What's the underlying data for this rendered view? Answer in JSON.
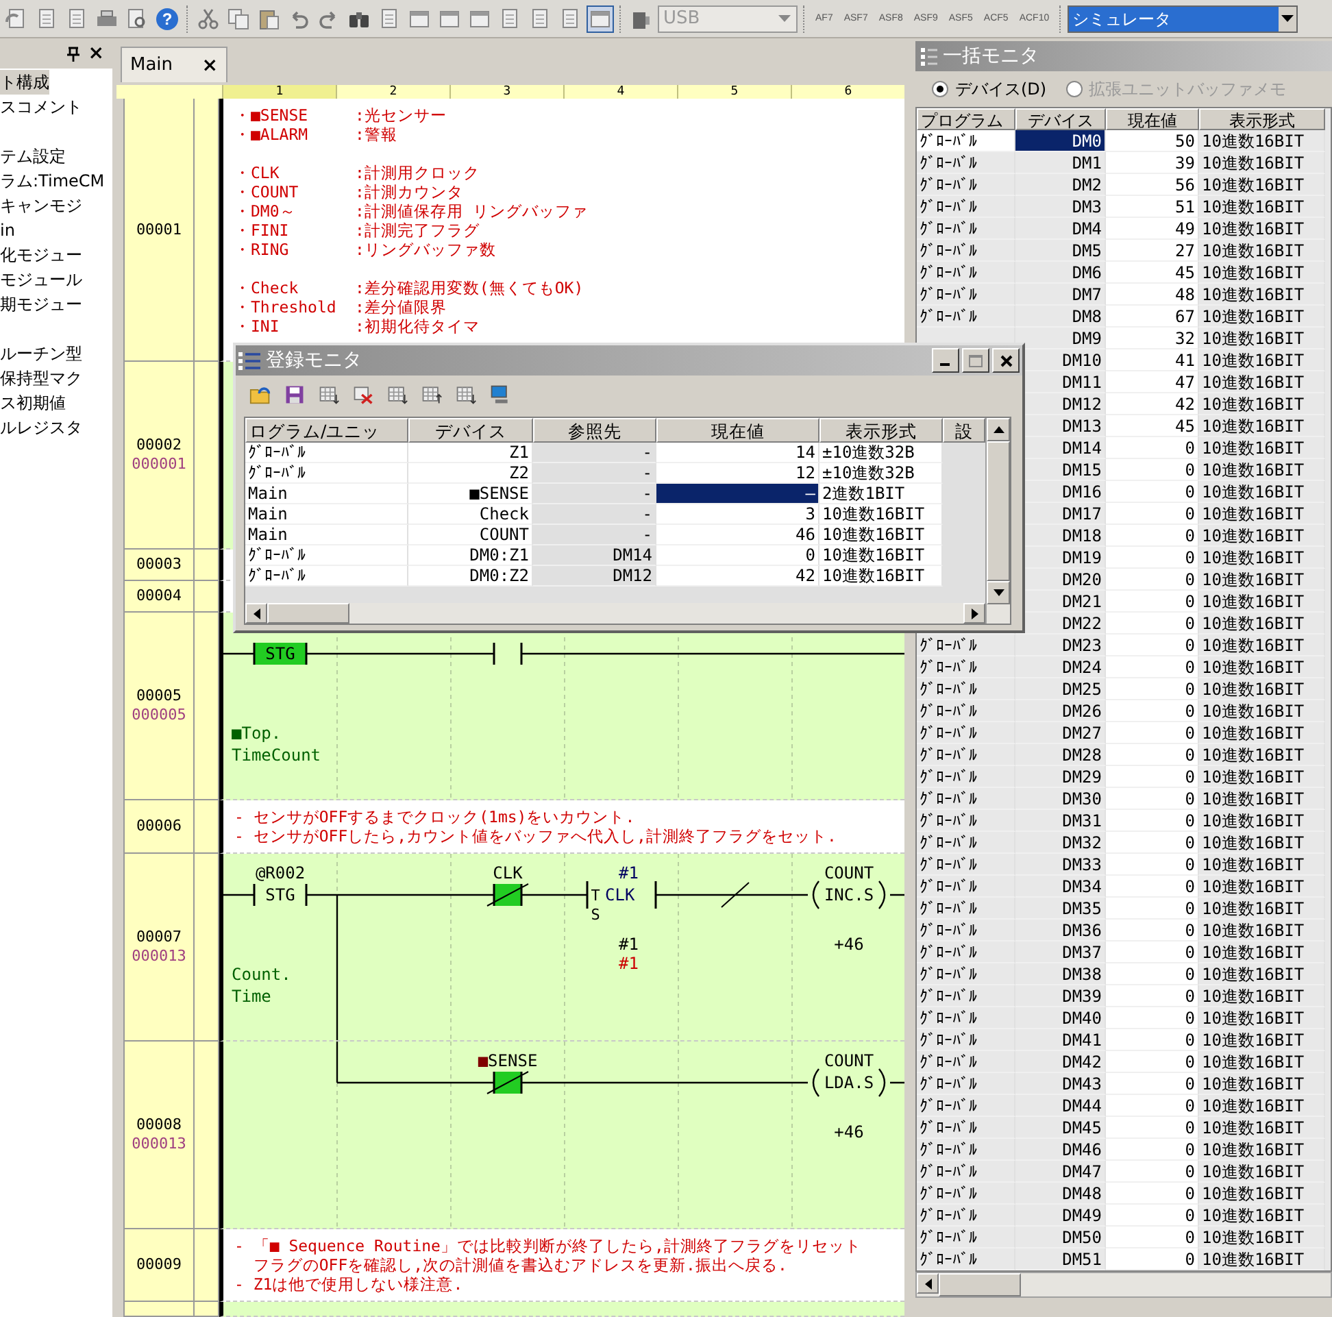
{
  "toolbar": {
    "help_glyph": "?",
    "connection": {
      "value": "USB",
      "disabled": true
    },
    "instruction_buttons": [
      "AF7",
      "ASF7",
      "ASF8",
      "ASF9",
      "ASF5",
      "ACF5",
      "ACF10"
    ],
    "mode": {
      "value": "シミュレータ"
    }
  },
  "project_panel": {
    "close_glyph": "×",
    "groups": [
      [
        {
          "label": "ト構成",
          "selected": true
        },
        {
          "label": "スコメント",
          "selected": false
        }
      ],
      [
        {
          "label": "テム設定",
          "selected": false
        },
        {
          "label": "ラム:TimeCM",
          "selected": false
        },
        {
          "label": "キャンモジ",
          "selected": false
        },
        {
          "label": "in",
          "selected": false
        },
        {
          "label": "化モジュー",
          "selected": false
        },
        {
          "label": "モジュール",
          "selected": false
        },
        {
          "label": "期モジュー",
          "selected": false
        }
      ],
      [
        {
          "label": "ルーチン型",
          "selected": false
        },
        {
          "label": "保持型マク",
          "selected": false
        },
        {
          "label": "ス初期値",
          "selected": false
        },
        {
          "label": "ルレジスタ",
          "selected": false
        }
      ]
    ]
  },
  "editor": {
    "tab": {
      "label": "Main",
      "close": "×"
    },
    "columns": [
      "1",
      "2",
      "3",
      "4",
      "5",
      "6"
    ],
    "rungs": [
      {
        "number": "00001",
        "kind": "comment",
        "groups": [
          [
            {
              "key": "・■SENSE",
              "text": ":光センサー"
            },
            {
              "key": "・■ALARM",
              "text": ":警報"
            }
          ],
          [
            {
              "key": "・CLK",
              "text": ":計測用クロック"
            },
            {
              "key": "・COUNT",
              "text": ":計測カウンタ"
            },
            {
              "key": "・DM0～",
              "text": ":計測値保存用 リングバッファ"
            },
            {
              "key": "・FINI",
              "text": ":計測完了フラグ"
            },
            {
              "key": "・RING",
              "text": ":リングバッファ数"
            }
          ],
          [
            {
              "key": "・Check",
              "text": ":差分確認用変数(無くてもOK)"
            },
            {
              "key": "・Threshold",
              "text": ":差分値限界"
            },
            {
              "key": "・INI",
              "text": ":初期化待タイマ"
            }
          ]
        ]
      },
      {
        "number": "00002",
        "step": "000001",
        "kind": "ladder"
      },
      {
        "number": "00003",
        "kind": "collapsed"
      },
      {
        "number": "00004",
        "kind": "collapsed"
      },
      {
        "number": "00005",
        "step": "000005",
        "kind": "ladder",
        "note": [
          "■Top.",
          "TimeCount"
        ],
        "cells": [
          {
            "kind": "contact",
            "inside": "STG",
            "on": true,
            "negated": false
          },
          {
            "kind": "wire"
          },
          {
            "kind": "contact",
            "on": false,
            "negated": false
          },
          {
            "kind": "wire"
          },
          {
            "kind": "wire"
          },
          {
            "kind": "wire"
          }
        ]
      },
      {
        "number": "00006",
        "kind": "comment",
        "groups": [
          [
            {
              "text": "- センサがOFFするまでクロック(1ms)をいカウント."
            },
            {
              "text": "- センサがOFFしたら,カウント値をバッファへ代入し,計測終了フラグをセット."
            }
          ]
        ]
      },
      {
        "number": "00007",
        "step": "000013",
        "kind": "ladder",
        "note": [
          "Count.",
          "Time"
        ],
        "cells": [
          {
            "kind": "contact",
            "above": "@R002",
            "inside": "STG",
            "on": false,
            "negated": false
          },
          {
            "kind": "branch_down"
          },
          {
            "kind": "contact",
            "above": "CLK",
            "on": true,
            "negated": true
          },
          {
            "kind": "timer",
            "flags": [
              "T",
              "S"
            ],
            "operand": "#1",
            "name": "CLK",
            "values": [
              {
                "text": "#1",
                "current": false
              },
              {
                "text": "#1",
                "current": true
              }
            ]
          },
          {
            "kind": "not"
          },
          {
            "kind": "coil",
            "above": "COUNT",
            "inside": "INC.S",
            "below": "+46"
          }
        ]
      },
      {
        "number": "00008",
        "step": "000013",
        "kind": "ladder",
        "cells": [
          {
            "kind": "empty"
          },
          {
            "kind": "branch_up"
          },
          {
            "kind": "contact",
            "mark": "■",
            "above": "SENSE",
            "on": true,
            "negated": true
          },
          {
            "kind": "wire"
          },
          {
            "kind": "wire"
          },
          {
            "kind": "coil",
            "above": "COUNT",
            "inside": "LDA.S",
            "below": "+46"
          }
        ]
      },
      {
        "number": "00009",
        "kind": "comment",
        "groups": [
          [
            {
              "text": "- 「■ Sequence Routine」では比較判断が終了したら,計測終了フラグをリセット"
            },
            {
              "text": "  フラグのOFFを確認し,次の計測値を書込むアドレスを更新.振出へ戻る."
            },
            {
              "text": "- Z1は他で使用しない様注意."
            }
          ]
        ]
      }
    ]
  },
  "registered_monitor": {
    "title": "登録モニタ",
    "columns": [
      "ログラム/ユニッ",
      "デバイス",
      "参照先",
      "現在値",
      "表示形式",
      "設"
    ],
    "rows": [
      {
        "program": "ｸﾞﾛｰﾊﾞﾙ",
        "device": "Z1",
        "reference": "-",
        "value": "14",
        "format": "±10進数32B",
        "selected": false
      },
      {
        "program": "ｸﾞﾛｰﾊﾞﾙ",
        "device": "Z2",
        "reference": "-",
        "value": "12",
        "format": "±10進数32B",
        "selected": false
      },
      {
        "program": "Main",
        "device": "■SENSE",
        "reference": "-",
        "value": "—",
        "format": "2進数1BIT",
        "selected": true
      },
      {
        "program": "Main",
        "device": "Check",
        "reference": "-",
        "value": "3",
        "format": "10進数16BIT",
        "selected": false
      },
      {
        "program": "Main",
        "device": "COUNT",
        "reference": "-",
        "value": "46",
        "format": "10進数16BIT",
        "selected": false
      },
      {
        "program": "ｸﾞﾛｰﾊﾞﾙ",
        "device": "DM0:Z1",
        "reference": "DM14",
        "value": "0",
        "format": "10進数16BIT",
        "selected": false
      },
      {
        "program": "ｸﾞﾛｰﾊﾞﾙ",
        "device": "DM0:Z2",
        "reference": "DM12",
        "value": "42",
        "format": "10進数16BIT",
        "selected": false
      }
    ]
  },
  "batch_monitor": {
    "title": "一括モニタ",
    "options": [
      {
        "label": "デバイス(D)",
        "selected": true,
        "disabled": false
      },
      {
        "label": "拡張ユニットバッファメモ",
        "selected": false,
        "disabled": true
      }
    ],
    "columns": [
      "プログラム",
      "デバイス",
      "現在値",
      "表示形式"
    ],
    "rows": [
      {
        "program": "ｸﾞﾛｰﾊﾞﾙ",
        "device": "DM0",
        "value": "50",
        "format": "10進数16BIT",
        "selected": true
      },
      {
        "program": "ｸﾞﾛｰﾊﾞﾙ",
        "device": "DM1",
        "value": "39",
        "format": "10進数16BIT",
        "selected": false
      },
      {
        "program": "ｸﾞﾛｰﾊﾞﾙ",
        "device": "DM2",
        "value": "56",
        "format": "10進数16BIT",
        "selected": false
      },
      {
        "program": "ｸﾞﾛｰﾊﾞﾙ",
        "device": "DM3",
        "value": "51",
        "format": "10進数16BIT",
        "selected": false
      },
      {
        "program": "ｸﾞﾛｰﾊﾞﾙ",
        "device": "DM4",
        "value": "49",
        "format": "10進数16BIT",
        "selected": false
      },
      {
        "program": "ｸﾞﾛｰﾊﾞﾙ",
        "device": "DM5",
        "value": "27",
        "format": "10進数16BIT",
        "selected": false
      },
      {
        "program": "ｸﾞﾛｰﾊﾞﾙ",
        "device": "DM6",
        "value": "45",
        "format": "10進数16BIT",
        "selected": false
      },
      {
        "program": "ｸﾞﾛｰﾊﾞﾙ",
        "device": "DM7",
        "value": "48",
        "format": "10進数16BIT",
        "selected": false
      },
      {
        "program": "ｸﾞﾛｰﾊﾞﾙ",
        "device": "DM8",
        "value": "67",
        "format": "10進数16BIT",
        "selected": false
      },
      {
        "device": "DM9",
        "value": "32",
        "format": "10進数16BIT",
        "selected": false
      },
      {
        "device": "DM10",
        "value": "41",
        "format": "10進数16BIT",
        "selected": false
      },
      {
        "device": "DM11",
        "value": "47",
        "format": "10進数16BIT",
        "selected": false
      },
      {
        "device": "DM12",
        "value": "42",
        "format": "10進数16BIT",
        "selected": false
      },
      {
        "device": "DM13",
        "value": "45",
        "format": "10進数16BIT",
        "selected": false
      },
      {
        "device": "DM14",
        "value": "0",
        "format": "10進数16BIT",
        "selected": false
      },
      {
        "device": "DM15",
        "value": "0",
        "format": "10進数16BIT",
        "selected": false
      },
      {
        "device": "DM16",
        "value": "0",
        "format": "10進数16BIT",
        "selected": false
      },
      {
        "device": "DM17",
        "value": "0",
        "format": "10進数16BIT",
        "selected": false
      },
      {
        "device": "DM18",
        "value": "0",
        "format": "10進数16BIT",
        "selected": false
      },
      {
        "device": "DM19",
        "value": "0",
        "format": "10進数16BIT",
        "selected": false
      },
      {
        "device": "DM20",
        "value": "0",
        "format": "10進数16BIT",
        "selected": false
      },
      {
        "device": "DM21",
        "value": "0",
        "format": "10進数16BIT",
        "selected": false
      },
      {
        "device": "DM22",
        "value": "0",
        "format": "10進数16BIT",
        "selected": false
      },
      {
        "program": "ｸﾞﾛｰﾊﾞﾙ",
        "device": "DM23",
        "value": "0",
        "format": "10進数16BIT",
        "selected": false
      },
      {
        "program": "ｸﾞﾛｰﾊﾞﾙ",
        "device": "DM24",
        "value": "0",
        "format": "10進数16BIT",
        "selected": false
      },
      {
        "program": "ｸﾞﾛｰﾊﾞﾙ",
        "device": "DM25",
        "value": "0",
        "format": "10進数16BIT",
        "selected": false
      },
      {
        "program": "ｸﾞﾛｰﾊﾞﾙ",
        "device": "DM26",
        "value": "0",
        "format": "10進数16BIT",
        "selected": false
      },
      {
        "program": "ｸﾞﾛｰﾊﾞﾙ",
        "device": "DM27",
        "value": "0",
        "format": "10進数16BIT",
        "selected": false
      },
      {
        "program": "ｸﾞﾛｰﾊﾞﾙ",
        "device": "DM28",
        "value": "0",
        "format": "10進数16BIT",
        "selected": false
      },
      {
        "program": "ｸﾞﾛｰﾊﾞﾙ",
        "device": "DM29",
        "value": "0",
        "format": "10進数16BIT",
        "selected": false
      },
      {
        "program": "ｸﾞﾛｰﾊﾞﾙ",
        "device": "DM30",
        "value": "0",
        "format": "10進数16BIT",
        "selected": false
      },
      {
        "program": "ｸﾞﾛｰﾊﾞﾙ",
        "device": "DM31",
        "value": "0",
        "format": "10進数16BIT",
        "selected": false
      },
      {
        "program": "ｸﾞﾛｰﾊﾞﾙ",
        "device": "DM32",
        "value": "0",
        "format": "10進数16BIT",
        "selected": false
      },
      {
        "program": "ｸﾞﾛｰﾊﾞﾙ",
        "device": "DM33",
        "value": "0",
        "format": "10進数16BIT",
        "selected": false
      },
      {
        "program": "ｸﾞﾛｰﾊﾞﾙ",
        "device": "DM34",
        "value": "0",
        "format": "10進数16BIT",
        "selected": false
      },
      {
        "program": "ｸﾞﾛｰﾊﾞﾙ",
        "device": "DM35",
        "value": "0",
        "format": "10進数16BIT",
        "selected": false
      },
      {
        "program": "ｸﾞﾛｰﾊﾞﾙ",
        "device": "DM36",
        "value": "0",
        "format": "10進数16BIT",
        "selected": false
      },
      {
        "program": "ｸﾞﾛｰﾊﾞﾙ",
        "device": "DM37",
        "value": "0",
        "format": "10進数16BIT",
        "selected": false
      },
      {
        "program": "ｸﾞﾛｰﾊﾞﾙ",
        "device": "DM38",
        "value": "0",
        "format": "10進数16BIT",
        "selected": false
      },
      {
        "program": "ｸﾞﾛｰﾊﾞﾙ",
        "device": "DM39",
        "value": "0",
        "format": "10進数16BIT",
        "selected": false
      },
      {
        "program": "ｸﾞﾛｰﾊﾞﾙ",
        "device": "DM40",
        "value": "0",
        "format": "10進数16BIT",
        "selected": false
      },
      {
        "program": "ｸﾞﾛｰﾊﾞﾙ",
        "device": "DM41",
        "value": "0",
        "format": "10進数16BIT",
        "selected": false
      },
      {
        "program": "ｸﾞﾛｰﾊﾞﾙ",
        "device": "DM42",
        "value": "0",
        "format": "10進数16BIT",
        "selected": false
      },
      {
        "program": "ｸﾞﾛｰﾊﾞﾙ",
        "device": "DM43",
        "value": "0",
        "format": "10進数16BIT",
        "selected": false
      },
      {
        "program": "ｸﾞﾛｰﾊﾞﾙ",
        "device": "DM44",
        "value": "0",
        "format": "10進数16BIT",
        "selected": false
      },
      {
        "program": "ｸﾞﾛｰﾊﾞﾙ",
        "device": "DM45",
        "value": "0",
        "format": "10進数16BIT",
        "selected": false
      },
      {
        "program": "ｸﾞﾛｰﾊﾞﾙ",
        "device": "DM46",
        "value": "0",
        "format": "10進数16BIT",
        "selected": false
      },
      {
        "program": "ｸﾞﾛｰﾊﾞﾙ",
        "device": "DM47",
        "value": "0",
        "format": "10進数16BIT",
        "selected": false
      },
      {
        "program": "ｸﾞﾛｰﾊﾞﾙ",
        "device": "DM48",
        "value": "0",
        "format": "10進数16BIT",
        "selected": false
      },
      {
        "program": "ｸﾞﾛｰﾊﾞﾙ",
        "device": "DM49",
        "value": "0",
        "format": "10進数16BIT",
        "selected": false
      },
      {
        "program": "ｸﾞﾛｰﾊﾞﾙ",
        "device": "DM50",
        "value": "0",
        "format": "10進数16BIT",
        "selected": false
      },
      {
        "program": "ｸﾞﾛｰﾊﾞﾙ",
        "device": "DM51",
        "value": "0",
        "format": "10進数16BIT",
        "selected": false
      }
    ]
  }
}
